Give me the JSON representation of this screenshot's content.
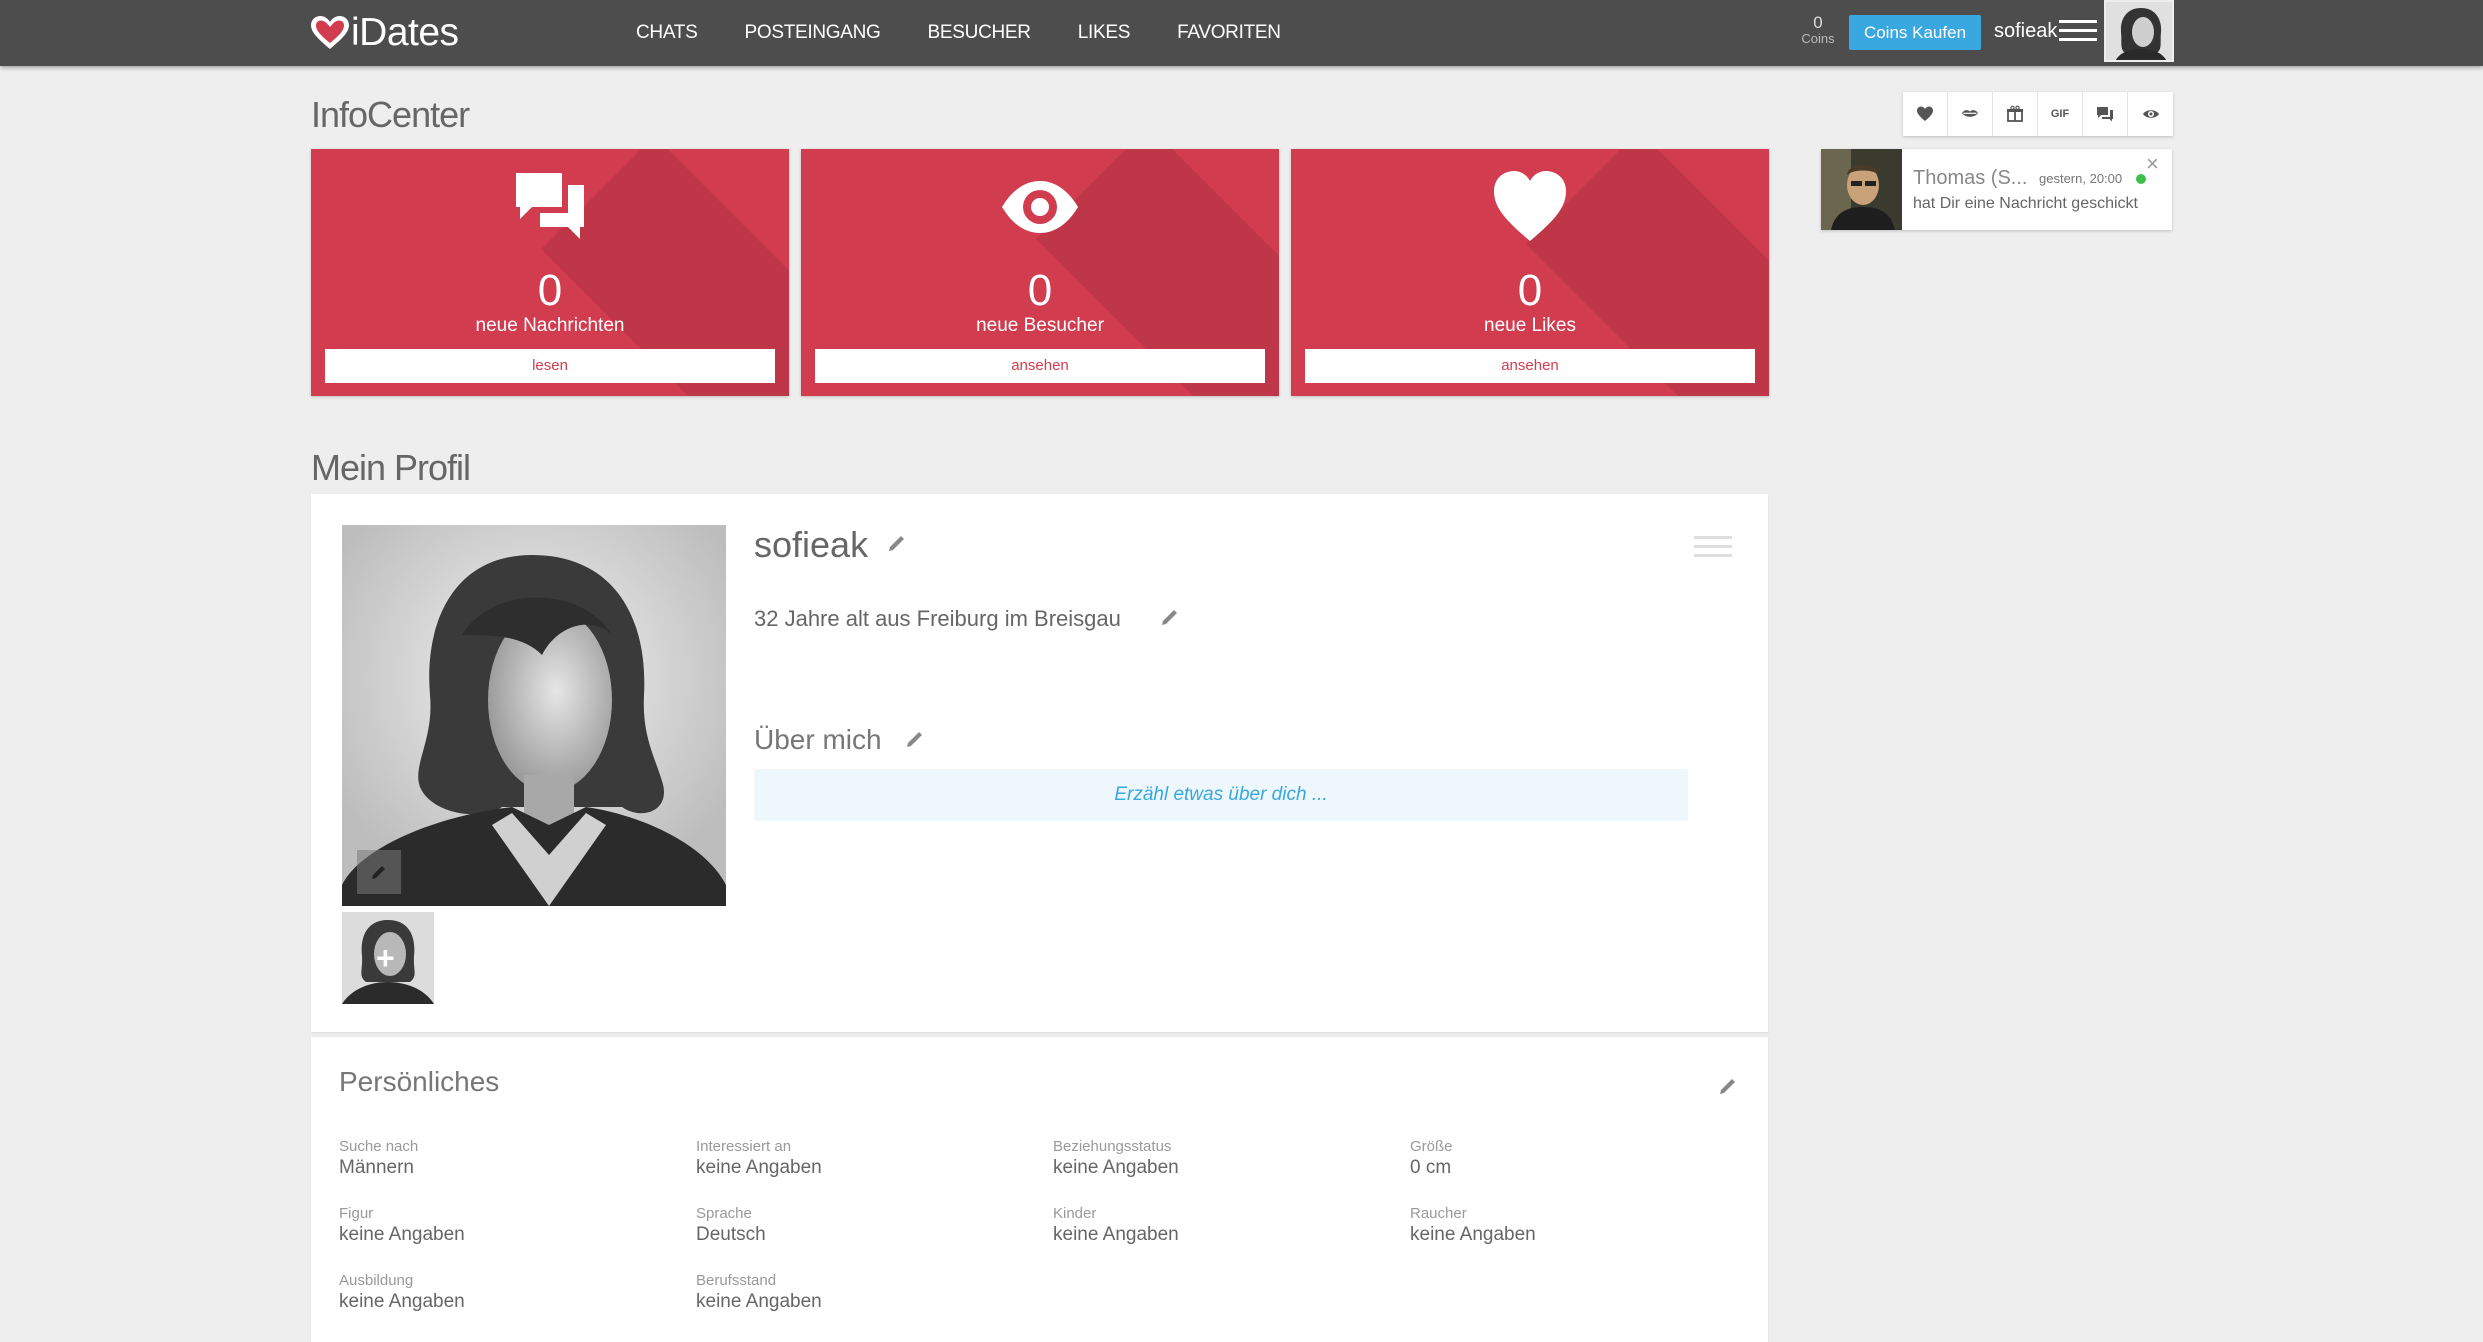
{
  "brand": {
    "name": "iDates"
  },
  "nav": {
    "links": [
      "CHATS",
      "POSTEINGANG",
      "BESUCHER",
      "LIKES",
      "FAVORITEN"
    ],
    "coins_value": "0",
    "coins_label": "Coins",
    "buy_label": "Coins Kaufen",
    "username": "sofieak"
  },
  "infocenter": {
    "title": "InfoCenter",
    "cards": [
      {
        "icon": "chat-bubbles-icon",
        "count": "0",
        "label": "neue Nachrichten",
        "button": "lesen"
      },
      {
        "icon": "eye-icon",
        "count": "0",
        "label": "neue Besucher",
        "button": "ansehen"
      },
      {
        "icon": "heart-icon",
        "count": "0",
        "label": "neue Likes",
        "button": "ansehen"
      }
    ]
  },
  "toolbar": {
    "icons": [
      "heart-icon",
      "kiss-icon",
      "gift-icon",
      "gif-icon",
      "chat-icon",
      "eye-icon"
    ],
    "gif_label": "GIF"
  },
  "notification": {
    "name": "Thomas (S...",
    "time": "gestern, 20:00",
    "message": "hat Dir eine Nachricht geschickt"
  },
  "profile": {
    "title": "Mein Profil",
    "username": "sofieak",
    "location": "32 Jahre alt aus Freiburg im Breisgau",
    "about_heading": "Über mich",
    "about_placeholder": "Erzähl etwas über dich ..."
  },
  "personal": {
    "title": "Persönliches",
    "fields": [
      {
        "key": "Suche nach",
        "value": "Männern"
      },
      {
        "key": "Interessiert an",
        "value": "keine Angaben"
      },
      {
        "key": "Beziehungsstatus",
        "value": "keine Angaben"
      },
      {
        "key": "Größe",
        "value": "0 cm"
      },
      {
        "key": "Figur",
        "value": "keine Angaben"
      },
      {
        "key": "Sprache",
        "value": "Deutsch"
      },
      {
        "key": "Kinder",
        "value": "keine Angaben"
      },
      {
        "key": "Raucher",
        "value": "keine Angaben"
      },
      {
        "key": "Ausbildung",
        "value": "keine Angaben"
      },
      {
        "key": "Berufsstand",
        "value": "keine Angaben"
      }
    ]
  },
  "colors": {
    "accent": "#d13c4f",
    "navbar": "#4d4d4d",
    "primary_button": "#3aa8e0",
    "online": "#3cc04a"
  }
}
